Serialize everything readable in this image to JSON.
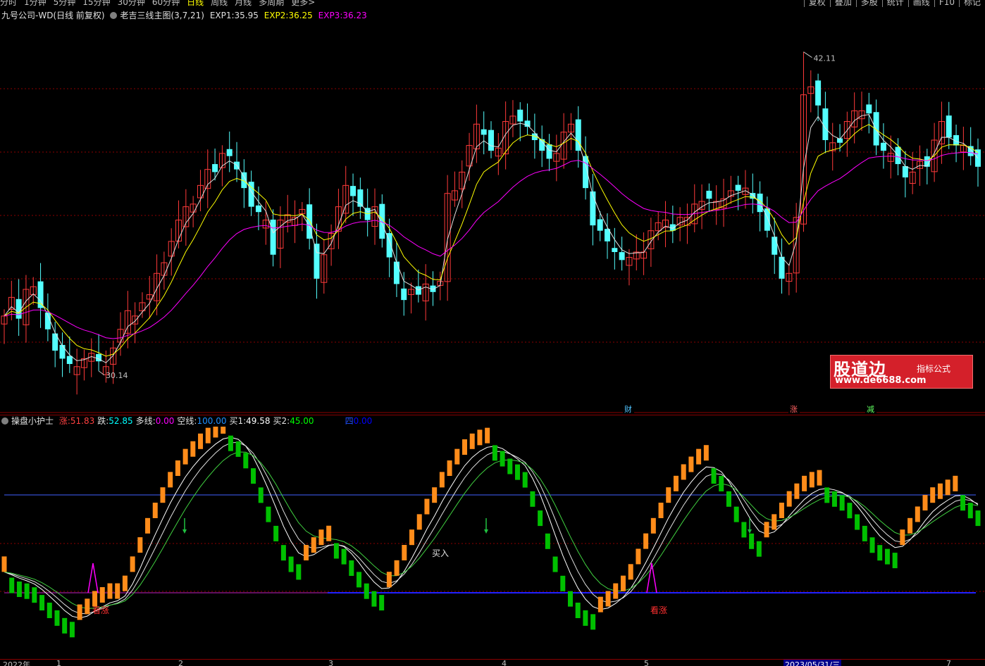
{
  "topbar": {
    "periods": [
      "分时",
      "1分钟",
      "5分钟",
      "15分钟",
      "30分钟",
      "60分钟",
      "日线",
      "周线",
      "月线",
      "多周期",
      "更多>"
    ],
    "active_period": "日线",
    "right_buttons": [
      "复权",
      "叠加",
      "多股",
      "统计",
      "画线",
      "F10",
      "标记"
    ]
  },
  "main_legend": {
    "stock": "九号公司-WD(日线 前复权)",
    "indicator": "老吉三线主图(3,7,21)",
    "exp1_label": "EXP1:",
    "exp1_value": "35.95",
    "exp2_label": "EXP2:",
    "exp2_value": "36.25",
    "exp3_label": "EXP3:",
    "exp3_value": "36.23",
    "exp1_color": "#e0e0e0",
    "exp2_color": "#ffff00",
    "exp3_color": "#ff00ff"
  },
  "price_labels": {
    "high": "42.11",
    "low": "30.14"
  },
  "event_tags": [
    "财",
    "涨",
    "减"
  ],
  "sub_legend": {
    "name": "操盘小护士",
    "items": [
      {
        "label": "涨:",
        "value": "51.83",
        "color": "#ff4040"
      },
      {
        "label": "跌:",
        "value": "52.85",
        "color": "#00ffff"
      },
      {
        "label": "多线:",
        "value": "0.00",
        "color": "#ff00ff"
      },
      {
        "label": "空线:",
        "value": "100.00",
        "color": "#1e90ff"
      },
      {
        "label": "买1:",
        "value": "49.58",
        "color": "#ffffff"
      },
      {
        "label": "买2:",
        "value": "45.00",
        "color": "#00ff00"
      },
      {
        "label": "四",
        "value": "0.00",
        "color": "#0000ff"
      }
    ]
  },
  "signals": {
    "kanzhang": "看涨",
    "mairu": "买入"
  },
  "watermark": {
    "title": "股道边",
    "subtitle": "指标公式",
    "url": "www.de6688.com"
  },
  "date_axis": [
    {
      "label": "2022年"
    },
    {
      "label": "1"
    },
    {
      "label": "2"
    },
    {
      "label": "3"
    },
    {
      "label": "4"
    },
    {
      "label": "5"
    },
    {
      "label": "2023/05/31/三",
      "highlight": true
    },
    {
      "label": "7"
    }
  ],
  "colors": {
    "up": "#ff3a3a",
    "down": "#54ffff",
    "grid": "#8b0000",
    "osc_up": "#ff8c1a",
    "osc_down": "#00c000"
  },
  "chart_data": {
    "type": "candlestick",
    "price_high_label": 42.11,
    "price_low_label": 30.14,
    "ema_periods": [
      3,
      7,
      21
    ],
    "closes": [
      32.2,
      32.9,
      32.1,
      33.2,
      33.3,
      32.5,
      31.7,
      30.9,
      30.6,
      30.4,
      30.3,
      30.6,
      30.8,
      30.5,
      30.3,
      31.0,
      31.7,
      32.4,
      32.2,
      32.7,
      33.0,
      33.8,
      34.2,
      35.0,
      35.8,
      36.3,
      36.4,
      37.1,
      37.7,
      37.6,
      38.3,
      38.2,
      37.7,
      37.0,
      36.3,
      36.1,
      35.8,
      34.5,
      35.8,
      36.0,
      35.9,
      36.2,
      35.1,
      33.6,
      34.5,
      35.3,
      36.3,
      37.1,
      36.7,
      36.3,
      35.8,
      36.3,
      35.1,
      34.4,
      33.4,
      32.8,
      33.2,
      33.0,
      33.4,
      33.1,
      33.5,
      36.8,
      36.9,
      37.6,
      38.6,
      39.4,
      39.0,
      38.4,
      38.5,
      39.5,
      39.7,
      39.5,
      39.3,
      38.8,
      38.4,
      38.1,
      38.3,
      39.1,
      39.4,
      38.4,
      37.0,
      35.6,
      35.4,
      35.0,
      34.6,
      34.3,
      34.4,
      34.6,
      34.6,
      35.4,
      35.7,
      35.8,
      35.4,
      35.9,
      35.9,
      36.4,
      36.5,
      36.6,
      36.5,
      36.6,
      36.9,
      36.9,
      37.0,
      36.6,
      36.1,
      35.4,
      34.5,
      33.6,
      33.8,
      35.9,
      40.5,
      40.8,
      40.1,
      38.8,
      38.7,
      38.7,
      39.5,
      39.9,
      39.9,
      39.8,
      38.6,
      38.4,
      38.3,
      37.9,
      37.4,
      37.6,
      38.0,
      37.8,
      38.8,
      39.5,
      38.9,
      38.6,
      38.6,
      38.2,
      37.8
    ],
    "oscillator": {
      "series": [
        "涨",
        "跌",
        "买1",
        "买2"
      ],
      "values": [
        38,
        35,
        33,
        32,
        30,
        26,
        22,
        18,
        14,
        12,
        13,
        16,
        20,
        22,
        24,
        24,
        28,
        38,
        48,
        58,
        66,
        74,
        82,
        88,
        94,
        98,
        102,
        105,
        108,
        110,
        109,
        106,
        100,
        92,
        82,
        72,
        62,
        52,
        46,
        42,
        44,
        48,
        52,
        54,
        53,
        50,
        44,
        38,
        32,
        28,
        26,
        30,
        36,
        44,
        52,
        60,
        68,
        74,
        82,
        88,
        94,
        99,
        102,
        104,
        105,
        104,
        101,
        97,
        94,
        90,
        80,
        70,
        58,
        46,
        36,
        28,
        22,
        18,
        16,
        17,
        20,
        24,
        28,
        34,
        42,
        50,
        58,
        66,
        74,
        80,
        86,
        90,
        94,
        96,
        92,
        88,
        80,
        72,
        64,
        58,
        54,
        56,
        60,
        66,
        72,
        76,
        80,
        82,
        83,
        82,
        80,
        78,
        74,
        68,
        62,
        56,
        52,
        50,
        48,
        52,
        58,
        64,
        70,
        74,
        76,
        78,
        80,
        78,
        74,
        70
      ],
      "upper_line": 80,
      "lower_line": 20
    }
  }
}
